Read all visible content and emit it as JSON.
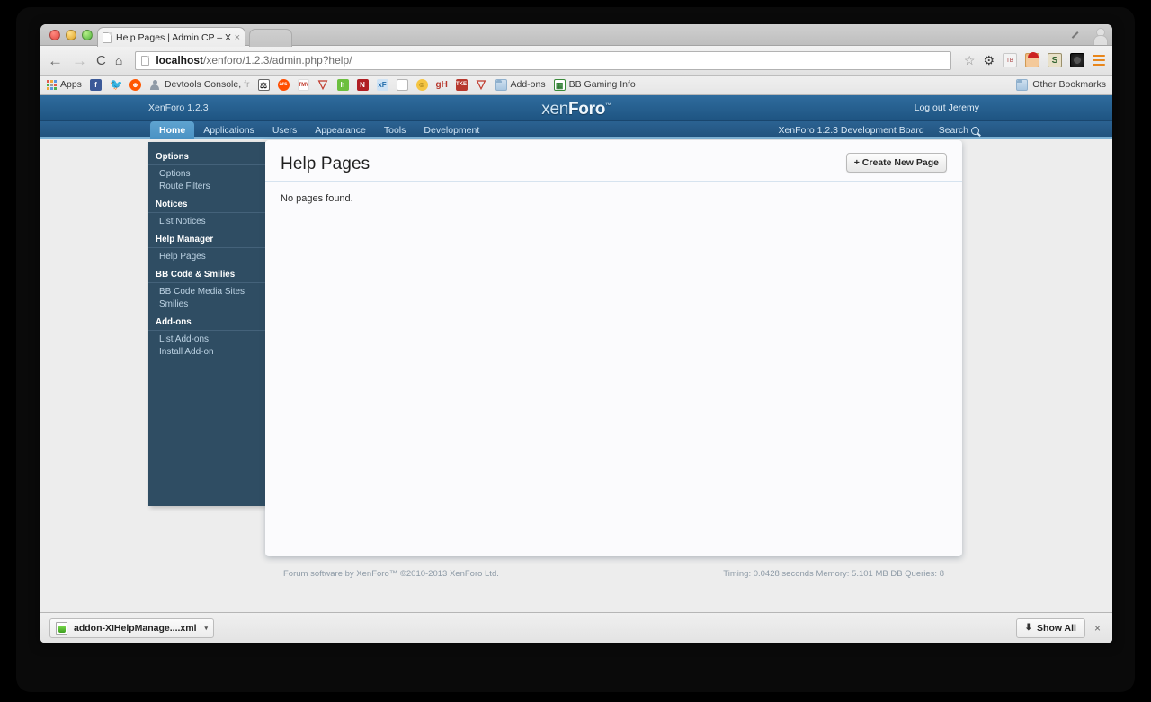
{
  "browser": {
    "tab": {
      "title": "Help Pages | Admin CP – X",
      "close_label": "×",
      "favicon": "page-icon"
    },
    "window_controls": {
      "close": "close-button",
      "minimize": "minimize-button",
      "zoom": "zoom-button",
      "fullscreen_icon": "expand-icon",
      "profile_icon": "person-icon"
    },
    "toolbar": {
      "back": "←",
      "forward": "→",
      "reload": "C",
      "home": "⌂",
      "url_host": "localhost",
      "url_path": "/xenforo/1.2.3/admin.php?help/",
      "star_icon": "☆",
      "gear_icon": "✽",
      "extensions": [
        "tb-icon",
        "santa-icon",
        "s-icon",
        "camera-icon"
      ],
      "menu_icon": "hamburger-menu-icon"
    },
    "bookmarks": {
      "apps_label": "Apps",
      "items": [
        {
          "icon": "facebook-icon",
          "glyph": "f",
          "label": ""
        },
        {
          "icon": "twitter-icon",
          "glyph": "🐦",
          "label": ""
        },
        {
          "icon": "reddit-icon",
          "glyph": "r",
          "label": ""
        },
        {
          "icon": "person-icon",
          "glyph": "",
          "label": "Devtools Console,",
          "dim": " fr"
        },
        {
          "icon": "group-icon",
          "glyph": "⚒",
          "label": ""
        },
        {
          "icon": "ars-technica-icon",
          "glyph": "ars",
          "label": ""
        },
        {
          "icon": "tmv-icon",
          "glyph": "TMV",
          "label": ""
        },
        {
          "icon": "v-icon",
          "glyph": "▽",
          "label": ""
        },
        {
          "icon": "hypixel-icon",
          "glyph": "h",
          "label": ""
        },
        {
          "icon": "netflix-icon",
          "glyph": "N",
          "label": ""
        },
        {
          "icon": "xenforo-icon",
          "glyph": "xF",
          "label": ""
        },
        {
          "icon": "blank-page-icon",
          "glyph": "",
          "label": ""
        },
        {
          "icon": "smiley-icon",
          "glyph": "☺",
          "label": ""
        },
        {
          "icon": "gh-icon",
          "glyph": "gH",
          "label": ""
        },
        {
          "icon": "tke-icon",
          "glyph": "TKE",
          "label": ""
        },
        {
          "icon": "v2-icon",
          "glyph": "▽",
          "label": ""
        },
        {
          "icon": "folder-icon",
          "glyph": "",
          "label": "Add-ons"
        },
        {
          "icon": "spreadsheet-icon",
          "glyph": "▤",
          "label": "BB Gaming Info"
        }
      ],
      "other_bookmarks": {
        "icon": "folder-icon",
        "label": "Other Bookmarks"
      }
    },
    "download_shelf": {
      "file_name": "addon-XIHelpManage....xml",
      "file_icon": "xml-file-icon",
      "caret": "▾",
      "show_all_label": "Show All",
      "show_all_icon": "⬇",
      "close_label": "×"
    }
  },
  "xenforo": {
    "header": {
      "version": "XenForo 1.2.3",
      "logo_prefix": "xen",
      "logo_suffix": "Foro",
      "logo_tm": "™",
      "logout": "Log out Jeremy"
    },
    "nav": {
      "tabs": [
        {
          "label": "Home",
          "active": true
        },
        {
          "label": "Applications",
          "active": false
        },
        {
          "label": "Users",
          "active": false
        },
        {
          "label": "Appearance",
          "active": false
        },
        {
          "label": "Tools",
          "active": false
        },
        {
          "label": "Development",
          "active": false
        }
      ],
      "board_link": "XenForo 1.2.3 Development Board",
      "search_label": "Search",
      "search_icon": "magnifier-icon"
    },
    "sidebar": {
      "groups": [
        {
          "heading": "Options",
          "links": [
            "Options",
            "Route Filters"
          ]
        },
        {
          "heading": "Notices",
          "links": [
            "List Notices"
          ]
        },
        {
          "heading": "Help Manager",
          "links": [
            "Help Pages"
          ]
        },
        {
          "heading": "BB Code & Smilies",
          "links": [
            "BB Code Media Sites",
            "Smilies"
          ]
        },
        {
          "heading": "Add-ons",
          "links": [
            "List Add-ons",
            "Install Add-on"
          ]
        }
      ]
    },
    "content": {
      "title": "Help Pages",
      "create_button": "+ Create New Page",
      "empty_message": "No pages found."
    },
    "footer": {
      "left": "Forum software by XenForo™ ©2010-2013 XenForo Ltd.",
      "right": "Timing: 0.0428 seconds Memory: 5.101 MB DB Queries: 8"
    }
  },
  "colors": {
    "xf_header_blue": "#1e5482",
    "xf_nav_blue": "#22537e",
    "xf_tab_active": "#5fa3d0",
    "xf_sidebar": "#2f4d63",
    "page_bg": "#ededed",
    "panel_bg": "#fbfbfd"
  }
}
